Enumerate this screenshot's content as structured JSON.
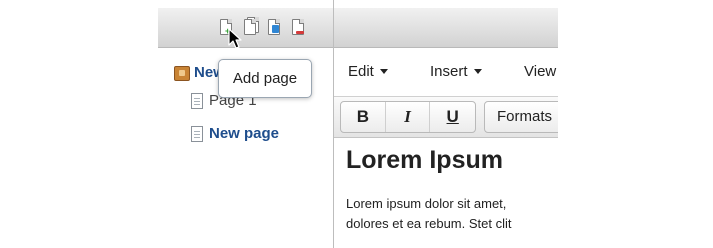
{
  "tree_toolbar": {
    "icons": [
      "add-page-icon",
      "copy-page-icon",
      "move-page-icon",
      "delete-page-icon"
    ]
  },
  "tooltip": {
    "text": "Add page"
  },
  "tree": {
    "items": [
      {
        "label": "New",
        "icon": "book-icon"
      },
      {
        "label": "Page 1",
        "icon": "page-icon"
      },
      {
        "label": "New page",
        "icon": "page-icon"
      }
    ]
  },
  "menubar": {
    "edit": "Edit",
    "insert": "Insert",
    "view": "View"
  },
  "toolbar": {
    "bold": "B",
    "italic": "I",
    "underline": "U",
    "formats": "Formats"
  },
  "content": {
    "heading": "Lorem Ipsum",
    "line1": "Lorem ipsum dolor sit amet,",
    "line2": "dolores et ea rebum. Stet clit"
  },
  "colors": {
    "link_blue": "#1e4d8c",
    "add_green": "#2e9e2e",
    "move_blue": "#2f86d4",
    "delete_red": "#d53a3a",
    "book_orange": "#c98435"
  }
}
